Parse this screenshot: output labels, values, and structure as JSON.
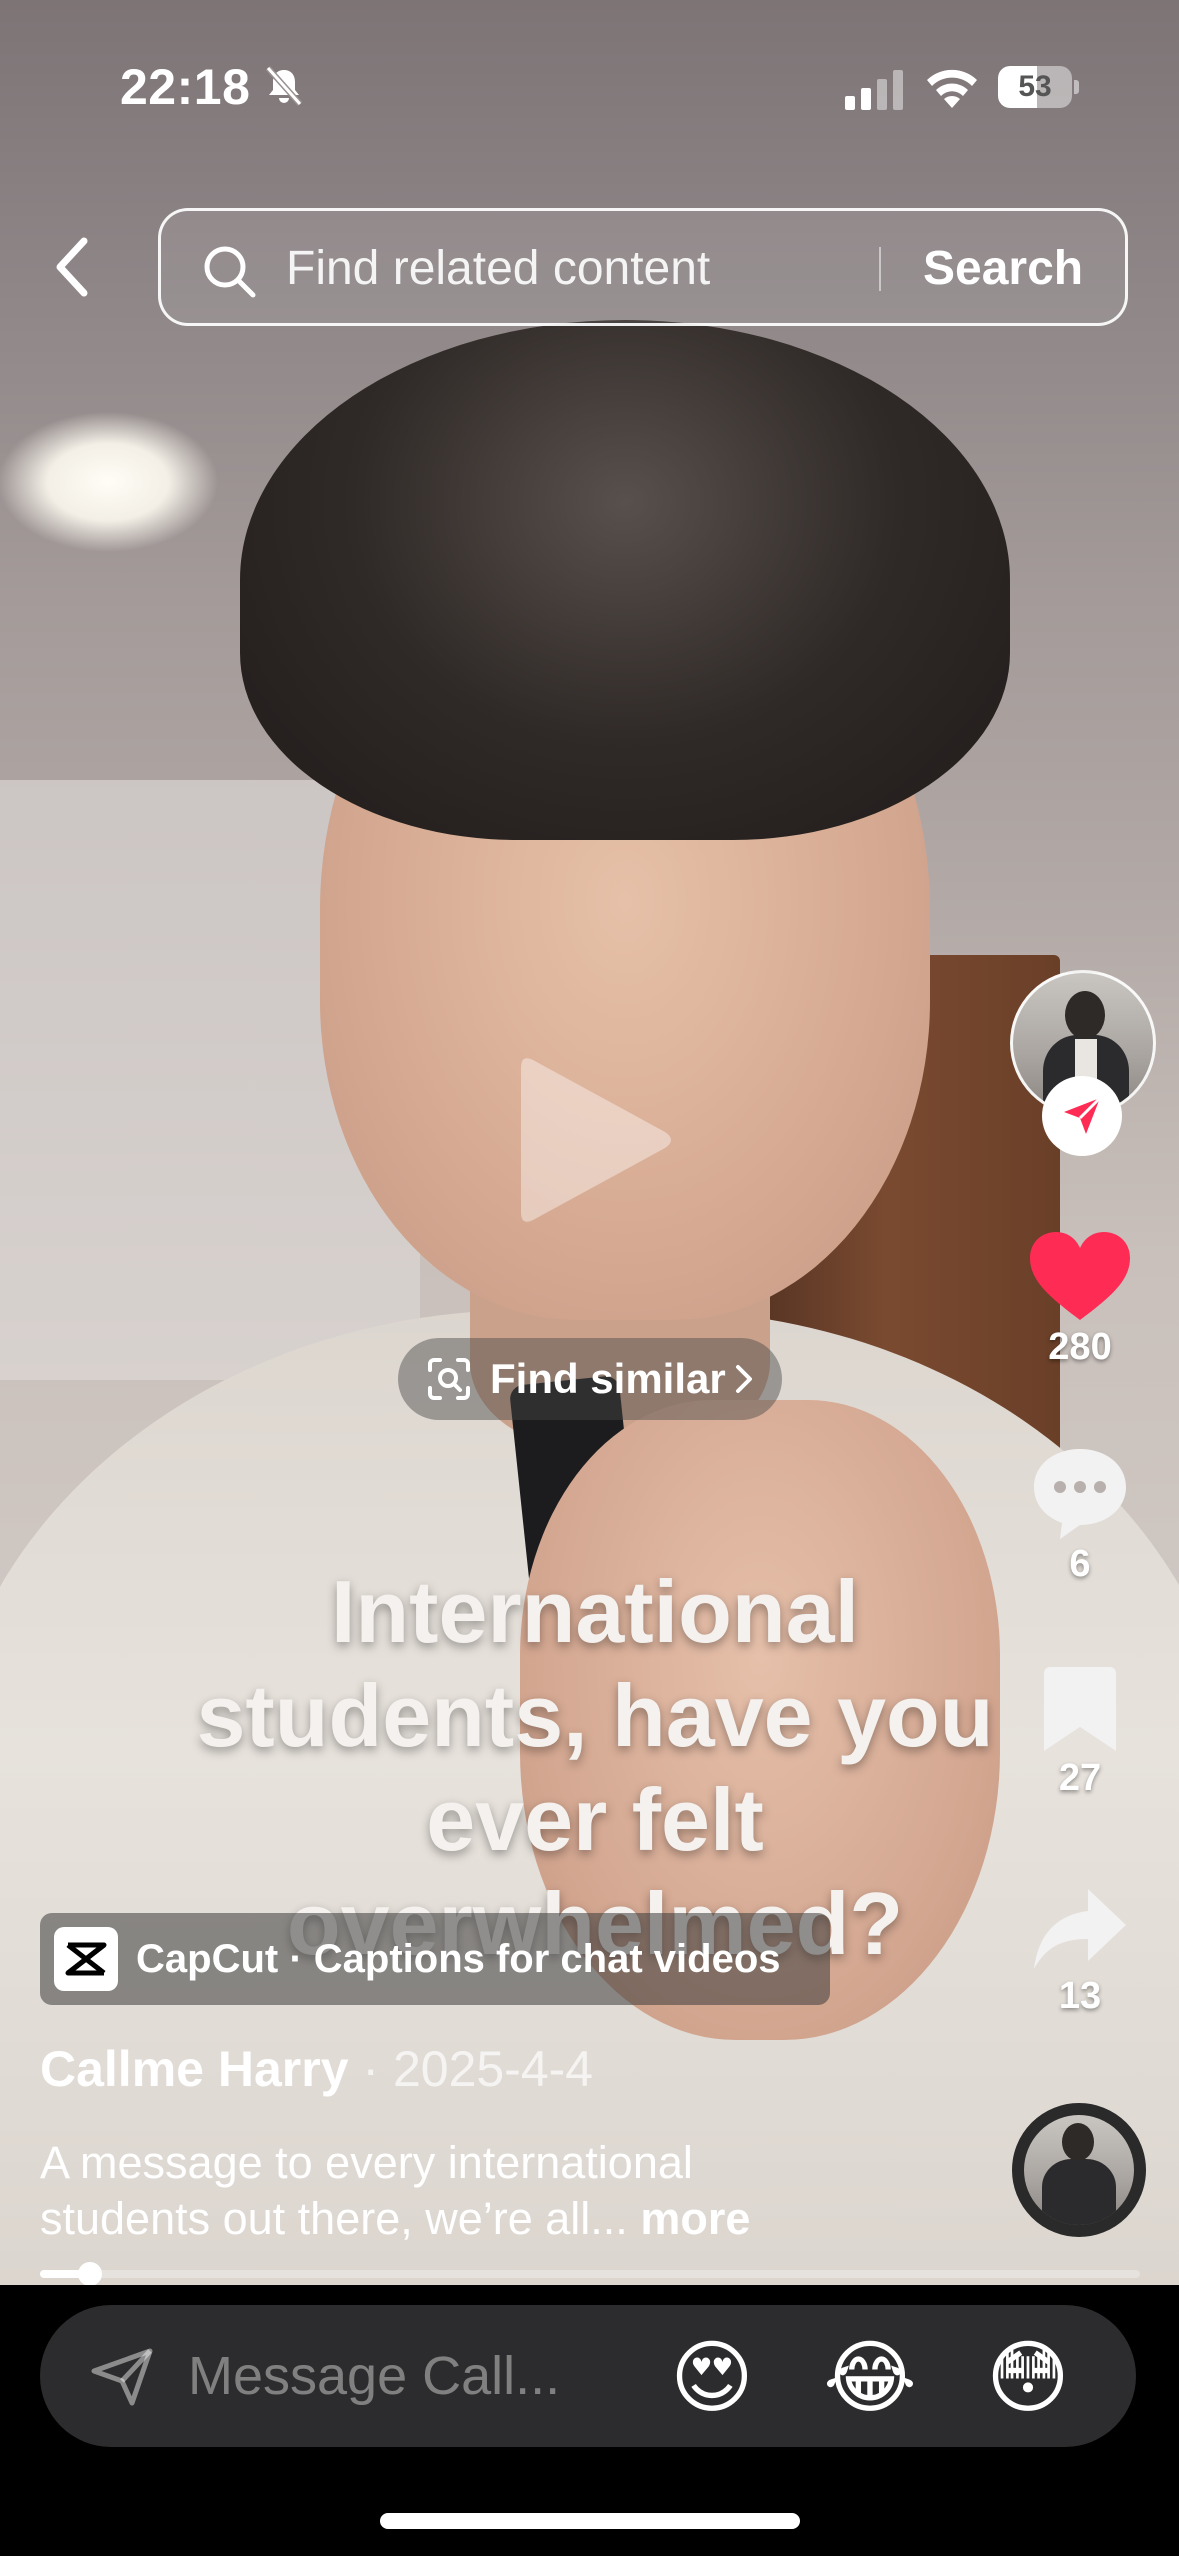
{
  "status_bar": {
    "time": "22:18",
    "battery_level": "53",
    "battery_fraction": 0.53
  },
  "search": {
    "placeholder": "Find related content",
    "button_label": "Search"
  },
  "overlay": {
    "find_similar_label": "Find similar",
    "caption_lines": [
      "International",
      "students, have you",
      "ever felt",
      "overwhelmed?"
    ]
  },
  "right_rail": {
    "like_count": "280",
    "comment_count": "6",
    "bookmark_count": "27",
    "share_count": "13"
  },
  "capcut": {
    "label": "CapCut · Captions for chat videos"
  },
  "post": {
    "author": "Callme Harry",
    "date": "2025-4-4",
    "description_line1": "A message to every international",
    "description_line2": "students out there, we’re all...",
    "more_label": "more"
  },
  "progress": {
    "fraction": 0.045
  },
  "message_bar": {
    "placeholder": "Message Call...",
    "emojis": [
      "😍",
      "😂",
      "😳"
    ]
  },
  "colors": {
    "like_red": "#fe2c55",
    "bar_bg": "#2c2c2e"
  }
}
